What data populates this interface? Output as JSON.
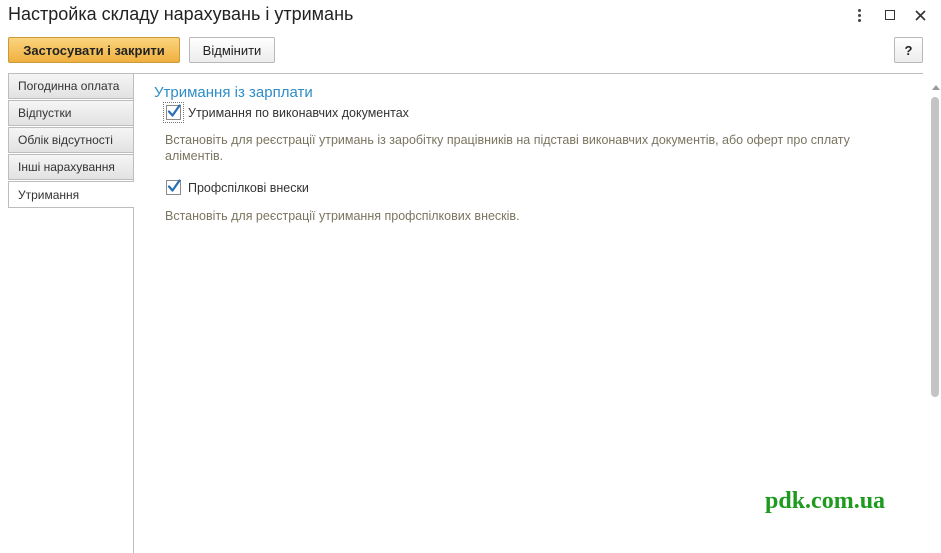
{
  "window": {
    "title": "Настройка складу нарахувань і утримань"
  },
  "toolbar": {
    "apply_label": "Застосувати і закрити",
    "cancel_label": "Відмінити",
    "help_label": "?"
  },
  "tabs": [
    {
      "label": "Погодинна оплата",
      "active": false
    },
    {
      "label": "Відпустки",
      "active": false
    },
    {
      "label": "Облік відсутності",
      "active": false
    },
    {
      "label": "Інші нарахування",
      "active": false
    },
    {
      "label": "Утримання",
      "active": true
    }
  ],
  "section": {
    "title": "Утримання із зарплати",
    "options": [
      {
        "label": "Утримання по виконавчих документах",
        "checked": true,
        "hint": "Встановіть для реєстрації утримань із заробітку працівників на підставі виконавчих документів, або оферт про сплату аліментів."
      },
      {
        "label": "Профспілкові внески",
        "checked": true,
        "hint": "Встановіть для реєстрації утримання профспілкових внесків."
      }
    ]
  },
  "watermark": "pdk.com.ua",
  "colors": {
    "accent": "#2f8dc7",
    "apply_button": "#f5c35a",
    "checkmark": "#2a6fb3",
    "hint_text": "#7a7560",
    "watermark": "#1e9a1e"
  },
  "icons": {
    "more": "more-vertical-icon",
    "maximize": "maximize-icon",
    "close": "close-icon",
    "check": "checkmark-icon"
  }
}
